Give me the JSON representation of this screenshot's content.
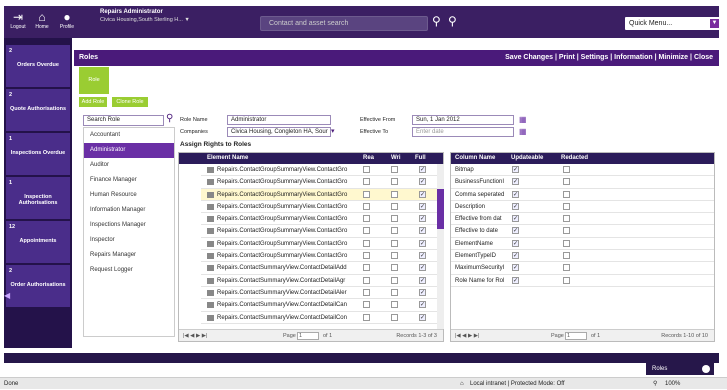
{
  "topbar": {
    "logout": "Logout",
    "home": "Home",
    "profile": "Profile",
    "user_title": "Repairs Administrator",
    "user_org": "Civica Housing,South Sterling H... ▼",
    "search_placeholder": "Contact and asset search",
    "quick_menu": "Quick Menu..."
  },
  "left_nav": [
    {
      "count": "2",
      "label": "Orders Overdue"
    },
    {
      "count": "2",
      "label": "Quote Authorisations"
    },
    {
      "count": "1",
      "label": "Inspections Overdue"
    },
    {
      "count": "1",
      "label": "Inspection Authorisations"
    },
    {
      "count": "12",
      "label": "Appointments"
    },
    {
      "count": "2",
      "label": "Order Authorisations"
    }
  ],
  "roles_panel": {
    "title": "Roles",
    "actions": [
      "Save Changes",
      "Print",
      "Settings",
      "Information",
      "Minimize",
      "Close"
    ],
    "role_btn": "Role",
    "add_role": "Add Role",
    "clone_role": "Clone Role",
    "search_role": "Search Role",
    "roles": [
      "Accountant",
      "Administrator",
      "Auditor",
      "Finance Manager",
      "Human Resource",
      "Information Manager",
      "Inspections Manager",
      "Inspector",
      "Repairs Manager",
      "Request Logger"
    ],
    "role_name_label": "Role Name",
    "role_name_value": "Administrator",
    "companies_label": "Companies",
    "companies_value": "Civica Housing, Congleton HA, Sour",
    "effective_from_label": "Effective From",
    "effective_from_value": "Sun, 1 Jan 2012",
    "effective_to_label": "Effective To",
    "effective_to_placeholder": "Enter date",
    "assign_rights": "Assign Rights to Roles"
  },
  "elements_grid": {
    "headers": [
      "Element Name",
      "Rea",
      "Wri",
      "Full"
    ],
    "rows": [
      {
        "name": "Repairs.ContactGroupSummaryView.ContactGro",
        "rea": false,
        "wri": false,
        "full": true
      },
      {
        "name": "Repairs.ContactGroupSummaryView.ContactGro",
        "rea": false,
        "wri": false,
        "full": true
      },
      {
        "name": "Repairs.ContactGroupSummaryView.ContactGro",
        "rea": false,
        "wri": false,
        "full": true
      },
      {
        "name": "Repairs.ContactGroupSummaryView.ContactGro",
        "rea": false,
        "wri": false,
        "full": true
      },
      {
        "name": "Repairs.ContactGroupSummaryView.ContactGro",
        "rea": false,
        "wri": false,
        "full": true
      },
      {
        "name": "Repairs.ContactGroupSummaryView.ContactGro",
        "rea": false,
        "wri": false,
        "full": true
      },
      {
        "name": "Repairs.ContactGroupSummaryView.ContactGro",
        "rea": false,
        "wri": false,
        "full": true
      },
      {
        "name": "Repairs.ContactGroupSummaryView.ContactGro",
        "rea": false,
        "wri": false,
        "full": true
      },
      {
        "name": "Repairs.ContactSummaryView.ContactDetailAdd",
        "rea": false,
        "wri": false,
        "full": true
      },
      {
        "name": "Repairs.ContactSummaryView.ContactDetailAgr",
        "rea": false,
        "wri": false,
        "full": true
      },
      {
        "name": "Repairs.ContactSummaryView.ContactDetailAler",
        "rea": false,
        "wri": false,
        "full": true
      },
      {
        "name": "Repairs.ContactSummaryView.ContactDetailCan",
        "rea": false,
        "wri": false,
        "full": true
      },
      {
        "name": "Repairs.ContactSummaryView.ContactDetailCon",
        "rea": false,
        "wri": false,
        "full": true
      }
    ],
    "pager_page": "Page",
    "pager_page_value": "1",
    "pager_of": "of 1",
    "pager_records": "Records 1-3 of 3"
  },
  "columns_grid": {
    "headers": [
      "Column Name",
      "Updateable",
      "Redacted"
    ],
    "rows": [
      {
        "name": "Bitmap",
        "upd": true,
        "red": false
      },
      {
        "name": "BusinessFunctionI",
        "upd": true,
        "red": false
      },
      {
        "name": "Comma seperated",
        "upd": true,
        "red": false
      },
      {
        "name": "Description",
        "upd": true,
        "red": false
      },
      {
        "name": "Effective from dat",
        "upd": true,
        "red": false
      },
      {
        "name": "Effective to date",
        "upd": true,
        "red": false
      },
      {
        "name": "ElementName",
        "upd": true,
        "red": false
      },
      {
        "name": "ElementTypeID",
        "upd": true,
        "red": false
      },
      {
        "name": "MaximumSecurityI",
        "upd": true,
        "red": false
      },
      {
        "name": "Role Name for Rol",
        "upd": true,
        "red": false
      }
    ],
    "pager_page": "Page",
    "pager_page_value": "1",
    "pager_of": "of 1",
    "pager_records": "Records 1-10 of 10"
  },
  "footer": {
    "roles_pill": "Roles",
    "status_done": "Done",
    "status_zone": "Local intranet | Protected Mode: Off",
    "zoom": "100%"
  },
  "colors": {
    "brand": "#3b1f63",
    "accent": "#9acd32",
    "selected": "#6a2fa5"
  }
}
